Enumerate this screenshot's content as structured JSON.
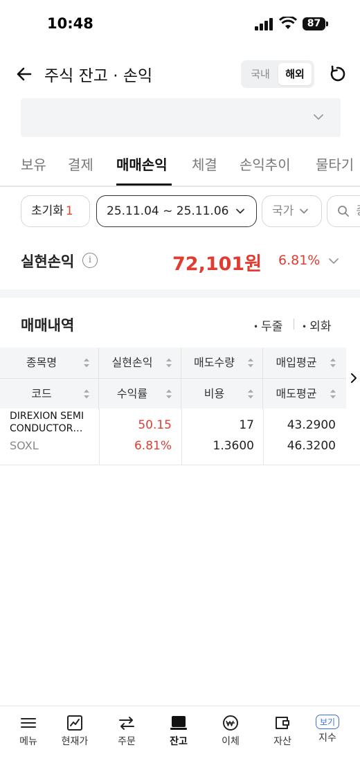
{
  "status": {
    "time": "10:48",
    "battery": "87"
  },
  "header": {
    "title": "주식 잔고 · 손익",
    "market_toggle": [
      "국내",
      "해외"
    ],
    "market_selected": "해외"
  },
  "tabs": [
    "보유",
    "결제",
    "매매손익",
    "체결",
    "손익추이",
    "물타기"
  ],
  "active_tab": "매매손익",
  "filters": {
    "reset_label": "초기화",
    "reset_count": "1",
    "date_range": "25.11.04 ~ 25.11.06",
    "country_label": "국가",
    "search_fragment": "종"
  },
  "realized": {
    "label": "실현손익",
    "amount": "72,101원",
    "rate": "6.81%"
  },
  "history": {
    "title": "매매내역",
    "option1": "두줄",
    "option2": "외화"
  },
  "table": {
    "headers_row1": [
      "종목명",
      "실현손익",
      "매도수량",
      "매입평균"
    ],
    "headers_row2": [
      "코드",
      "수익률",
      "비용",
      "매도평균"
    ],
    "rows": [
      {
        "name_line1": "DIREXION SEMI",
        "name_line2": "CONDUCTOR…",
        "code": "SOXL",
        "realized": "50.15",
        "return_rate": "6.81%",
        "sell_qty": "17",
        "cost": "1.3600",
        "buy_avg": "43.2900",
        "sell_avg": "46.3200"
      }
    ]
  },
  "bottom_nav": [
    {
      "label": "메뉴",
      "icon": "menu-icon"
    },
    {
      "label": "현재가",
      "icon": "chart-icon"
    },
    {
      "label": "주문",
      "icon": "swap-icon"
    },
    {
      "label": "잔고",
      "icon": "wallet-balance-icon"
    },
    {
      "label": "이체",
      "icon": "transfer-icon"
    },
    {
      "label": "자산",
      "icon": "assets-icon"
    },
    {
      "label": "지수",
      "icon": "index-icon",
      "badge": "보기"
    }
  ],
  "bottom_nav_active": "잔고",
  "colors": {
    "red": "#e03c31",
    "accent_blue": "#3b6fe0",
    "reset_count": "#e0452c"
  }
}
